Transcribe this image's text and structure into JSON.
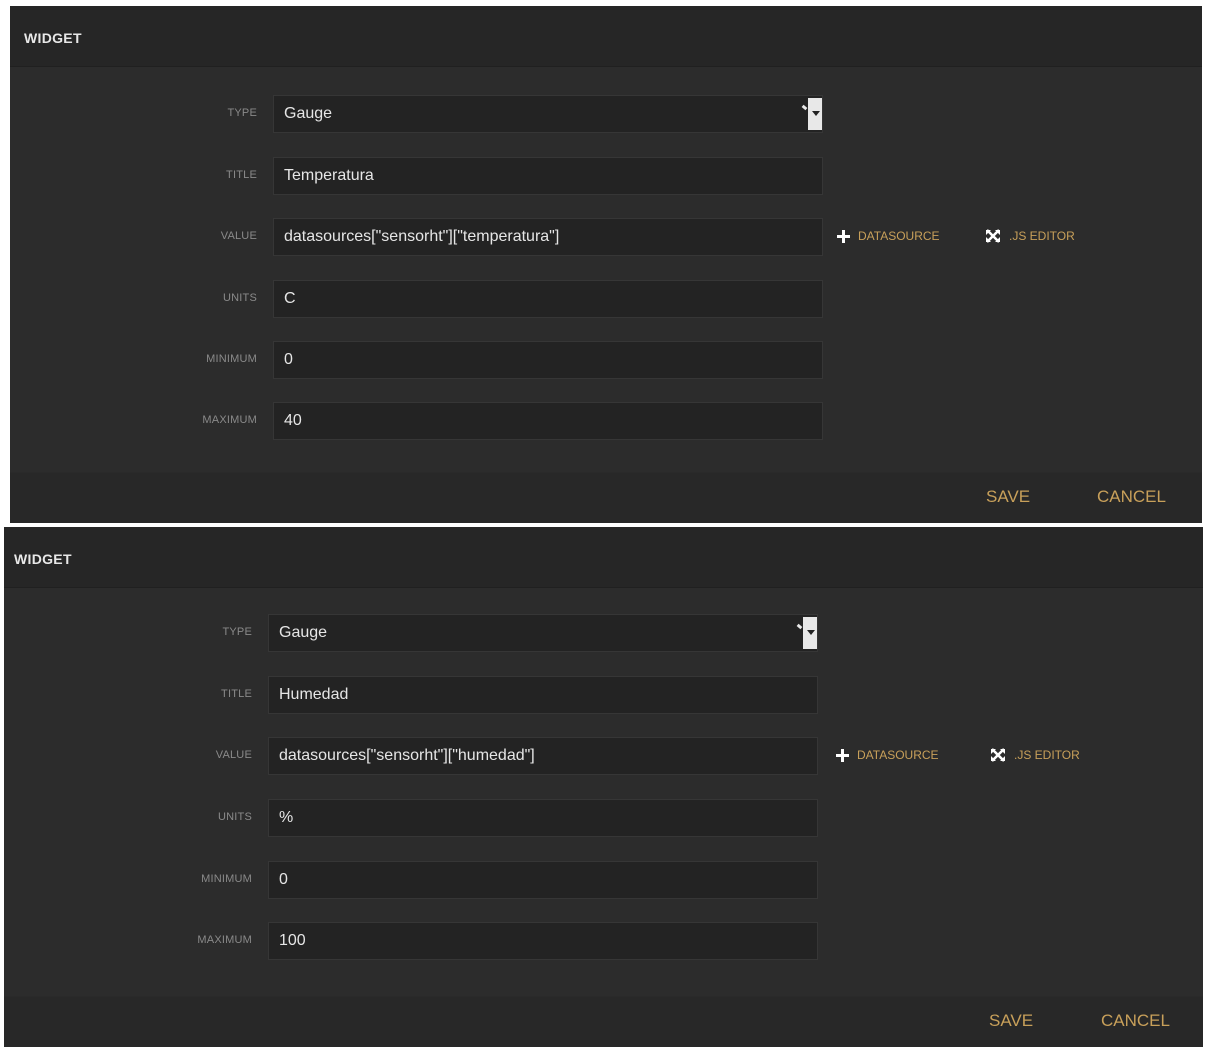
{
  "panels": [
    {
      "title": "WIDGET",
      "fields": {
        "type": {
          "label": "TYPE",
          "value": "Gauge"
        },
        "title": {
          "label": "TITLE",
          "value": "Temperatura"
        },
        "value": {
          "label": "VALUE",
          "value": "datasources[\"sensorht\"][\"temperatura\"]"
        },
        "units": {
          "label": "UNITS",
          "value": "C"
        },
        "minimum": {
          "label": "MINIMUM",
          "value": "0"
        },
        "maximum": {
          "label": "MAXIMUM",
          "value": "40"
        }
      },
      "actions": {
        "datasource": "DATASOURCE",
        "js_editor": ".JS EDITOR"
      },
      "footer": {
        "save": "SAVE",
        "cancel": "CANCEL"
      }
    },
    {
      "title": "WIDGET",
      "fields": {
        "type": {
          "label": "TYPE",
          "value": "Gauge"
        },
        "title": {
          "label": "TITLE",
          "value": "Humedad"
        },
        "value": {
          "label": "VALUE",
          "value": "datasources[\"sensorht\"][\"humedad\"]"
        },
        "units": {
          "label": "UNITS",
          "value": "%"
        },
        "minimum": {
          "label": "MINIMUM",
          "value": "0"
        },
        "maximum": {
          "label": "MAXIMUM",
          "value": "100"
        }
      },
      "actions": {
        "datasource": "DATASOURCE",
        "js_editor": ".JS EDITOR"
      },
      "footer": {
        "save": "SAVE",
        "cancel": "CANCEL"
      }
    }
  ],
  "colors": {
    "panel_bg": "#2a2a2a",
    "input_bg": "#232323",
    "accent": "#c8a05a",
    "label": "#8a8a8a",
    "text": "#e6e6e6"
  },
  "icons": {
    "add": "plus-icon",
    "editor": "fullscreen-icon",
    "select": "chevron-down-icon"
  }
}
